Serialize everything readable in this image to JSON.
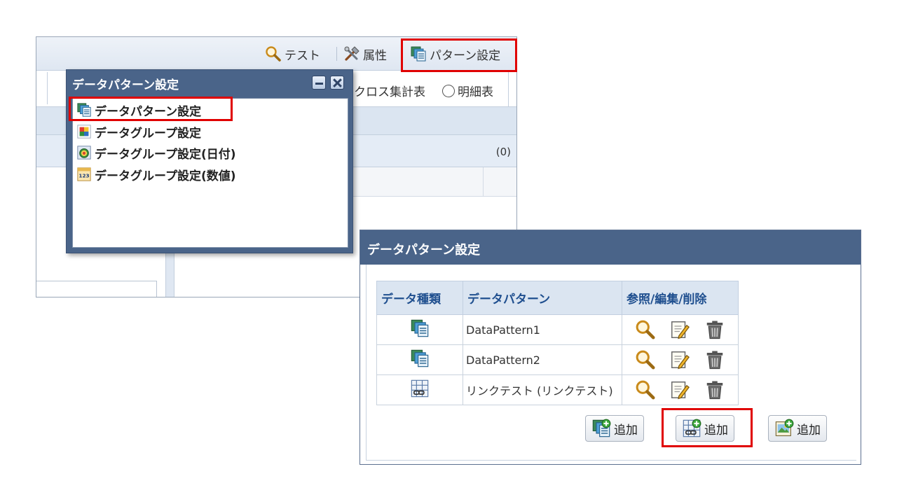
{
  "toolbar": {
    "test_label": "テスト",
    "attribute_label": "属性",
    "pattern_label": "パターン設定"
  },
  "options": {
    "cross_label": "クロス集計表",
    "detail_label": "明細表"
  },
  "list": {
    "count": "(0)"
  },
  "popup": {
    "title": "データパターン設定",
    "items": [
      {
        "label": "データパターン設定",
        "icon": "data-pattern-icon"
      },
      {
        "label": "データグループ設定",
        "icon": "data-group-icon"
      },
      {
        "label": "データグループ設定(日付)",
        "icon": "data-group-date-icon"
      },
      {
        "label": "データグループ設定(数値)",
        "icon": "data-group-number-icon"
      }
    ]
  },
  "dialog": {
    "title": "データパターン設定",
    "table": {
      "headers": [
        "データ種類",
        "データパターン",
        "参照/編集/削除"
      ],
      "rows": [
        {
          "kind_icon": "data-pattern-icon",
          "name": "DataPattern1"
        },
        {
          "kind_icon": "data-pattern-icon",
          "name": "DataPattern2"
        },
        {
          "kind_icon": "link-test-icon",
          "name": "リンクテスト (リンクテスト)"
        }
      ]
    },
    "add_buttons": [
      {
        "label": "追加",
        "icon": "add-data-pattern-icon"
      },
      {
        "label": "追加",
        "icon": "add-link-pattern-icon"
      },
      {
        "label": "追加",
        "icon": "add-image-pattern-icon"
      }
    ]
  },
  "colors": {
    "title_bar": "#4a6489",
    "header_bg": "#dbe5f1",
    "header_text": "#1f4f8f",
    "highlight": "#e00000"
  }
}
